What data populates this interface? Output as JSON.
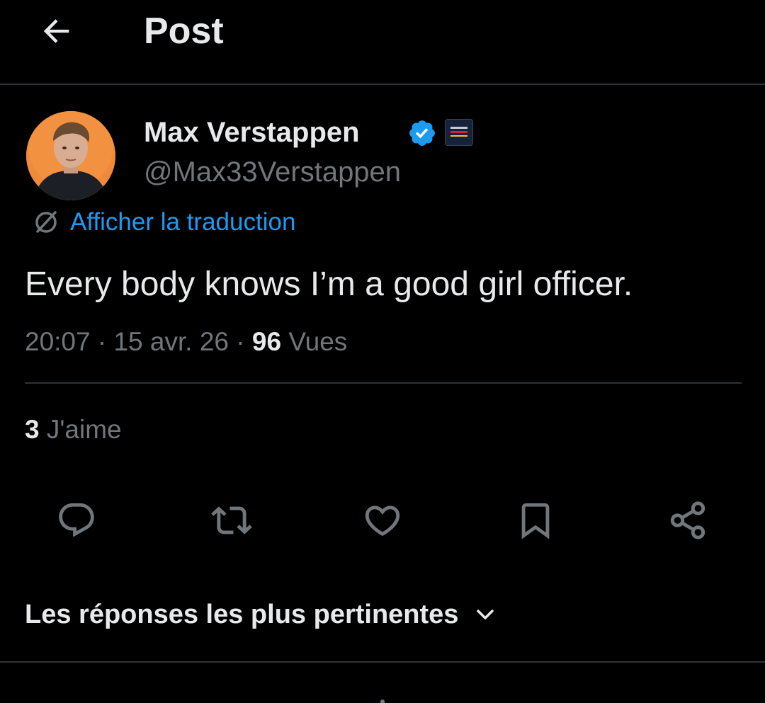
{
  "header": {
    "title": "Post"
  },
  "author": {
    "name": "Max Verstappen",
    "handle": "@Max33Verstappen",
    "verified": true,
    "verified_color": "#1d9bf0",
    "avatar_bg": "#f08a3a"
  },
  "translate": {
    "label": "Afficher la traduction",
    "color": "#1d9bf0"
  },
  "tweet": {
    "text": "Every body knows I’m a good girl officer."
  },
  "meta": {
    "time": "20:07",
    "separator": "·",
    "date": "15 avr. 26",
    "views_count": "96",
    "views_label": "Vues"
  },
  "likes": {
    "count": "3",
    "label": "J'aime"
  },
  "actions": {
    "reply_icon": "reply-icon",
    "repost_icon": "repost-icon",
    "like_icon": "heart-icon",
    "bookmark_icon": "bookmark-icon",
    "share_icon": "share-icon",
    "icon_color": "#71767b"
  },
  "replies_sort": {
    "label": "Les réponses les plus pertinentes"
  },
  "colors": {
    "background": "#000000",
    "text_primary": "#e7e9ea",
    "text_secondary": "#71767b",
    "divider": "#2f3336",
    "accent": "#1d9bf0"
  }
}
